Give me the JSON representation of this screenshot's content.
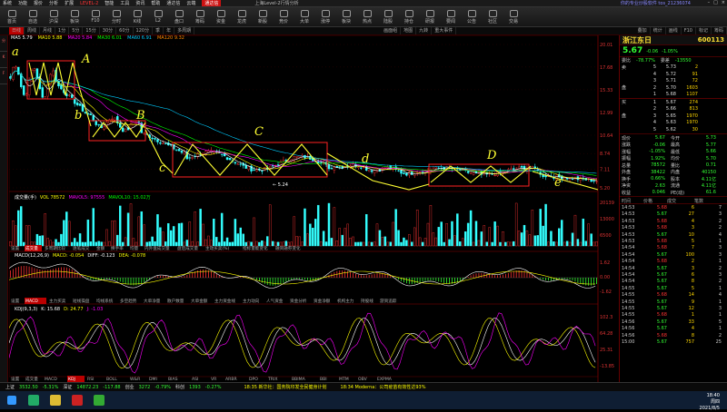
{
  "menubar": {
    "items": [
      "系统",
      "功能",
      "报价",
      "分析",
      "扩展",
      "LEVEL-2",
      "智能",
      "工具",
      "资讯",
      "帮助",
      "通达信",
      "云端"
    ],
    "brand": "通达信",
    "title": "上海Level-2行情分析",
    "user": "你的专业炒股软件 tos_21236074"
  },
  "toolbar": {
    "items": [
      "首页",
      "自选",
      "沪深",
      "板块",
      "F10",
      "分时",
      "K线",
      "L2",
      "盘口",
      "筹码",
      "资金",
      "龙虎",
      "新股",
      "竞价",
      "大单",
      "涨停",
      "板块",
      "热点",
      "陆股",
      "持仓",
      "研报",
      "要闻",
      "公告",
      "社区",
      "交易"
    ]
  },
  "chart_header": {
    "tabs": [
      "日线",
      "周线",
      "月线",
      "1分",
      "5分",
      "15分",
      "30分",
      "60分",
      "120分",
      "季",
      "年",
      "多周期"
    ],
    "ma_labels": [
      "MA5 5.79",
      "MA10 5.88",
      "MA20 5.84",
      "MA30 6.01",
      "MA60 6.91",
      "MA120 9.32"
    ],
    "right_tabs": [
      "叠加",
      "统计",
      "画线",
      "F10",
      "标记",
      "筹码"
    ],
    "event_tabs": [
      "画面组",
      "地图",
      "九转",
      "重大事件"
    ]
  },
  "price_axis": [
    "20.01",
    "17.68",
    "15.33",
    "12.99",
    "10.64",
    "8.74",
    "7.11",
    "5.20"
  ],
  "annotations": [
    "a",
    "A",
    "b",
    "B",
    "c",
    "C",
    "d",
    "D",
    "e"
  ],
  "volume_panel": {
    "title": "成交量(手)",
    "vol": "VOL 78572",
    "mavol5": "MAVOL5: 97555",
    "mavol10": "MAVOL10: 15.02万",
    "axis": [
      "20139",
      "13000",
      "6500"
    ],
    "tabs": [
      "设置",
      "成交量",
      "多周期比较",
      "逐笔成交",
      "金额",
      "换手率",
      "均量",
      "内外盘成交量",
      "盘后成交量",
      "主动买卖(%)",
      "指标量能变化",
      "融资融券变化"
    ]
  },
  "macd_panel": {
    "title": "MACD(12,26,9)",
    "macd": "MACD: -0.054",
    "diff": "DIFF: -0.123",
    "dea": "DEA: -0.078",
    "axis": [
      "1.62",
      "0.00",
      "-1.62"
    ],
    "tabs": [
      "设置",
      "MACD",
      "主力买卖",
      "短线操盘",
      "均线系统",
      "多空趋势",
      "大单净量",
      "散户数量",
      "大单金额",
      "主力资金线",
      "主力动向",
      "人气资金",
      "资金分析",
      "资金净额",
      "机构主力",
      "持股线",
      "游资追踪"
    ]
  },
  "kdj_panel": {
    "title": "KDJ(9,3,3)",
    "k": "K: 15.68",
    "d": "D: 24.77",
    "j": "J: -1.03",
    "axis": [
      "102.3",
      "64.28",
      "25.31",
      "-13.85"
    ],
    "tabs": [
      "设置",
      "成交量",
      "MACD",
      "KDJ",
      "RSI",
      "BOLL",
      "W&R",
      "DMI",
      "BIAS",
      "ASI",
      "VR",
      "ARBR",
      "DPO",
      "TRIX",
      "BBIMA",
      "BBI",
      "MTM",
      "OBV",
      "EXPMA"
    ]
  },
  "stock": {
    "name": "浙江东日",
    "code": "600113",
    "price": "5.67",
    "change": "-0.06",
    "pct": "-1.05%"
  },
  "order_book": {
    "header": [
      "委比",
      "-78.77%",
      "委差",
      "-13550"
    ],
    "asks": [
      {
        "label": "卖",
        "lv": "5",
        "price": "5.73",
        "vol": "2"
      },
      {
        "label": "",
        "lv": "4",
        "price": "5.72",
        "vol": "91"
      },
      {
        "label": "",
        "lv": "3",
        "price": "5.71",
        "vol": "72"
      },
      {
        "label": "盘",
        "lv": "2",
        "price": "5.70",
        "vol": "1603"
      },
      {
        "label": "",
        "lv": "1",
        "price": "5.68",
        "vol": "1107"
      }
    ],
    "bids": [
      {
        "label": "买",
        "lv": "1",
        "price": "5.67",
        "vol": "274"
      },
      {
        "label": "",
        "lv": "2",
        "price": "5.66",
        "vol": "813"
      },
      {
        "label": "盘",
        "lv": "3",
        "price": "5.65",
        "vol": "1970"
      },
      {
        "label": "",
        "lv": "4",
        "price": "5.63",
        "vol": "1970"
      },
      {
        "label": "",
        "lv": "5",
        "price": "5.62",
        "vol": "30"
      }
    ]
  },
  "stats": [
    [
      "现价",
      "5.67",
      "今开",
      "5.73"
    ],
    [
      "涨跌",
      "-0.06",
      "最高",
      "5.77"
    ],
    [
      "涨幅",
      "-1.05%",
      "最低",
      "5.66"
    ],
    [
      "振幅",
      "1.92%",
      "均价",
      "5.70"
    ],
    [
      "总量",
      "78572",
      "量比",
      "0.71"
    ],
    [
      "外盘",
      "38422",
      "内盘",
      "40150"
    ],
    [
      "换手",
      "0.66%",
      "股本",
      "4.11亿"
    ],
    [
      "净资",
      "2.63",
      "流通",
      "4.11亿"
    ],
    [
      "收益",
      "0.046",
      "PE(动)",
      "61.6"
    ]
  ],
  "ticks_header": [
    "时间",
    "价格",
    "成交",
    "笔数"
  ],
  "ticks": [
    [
      "14:53",
      "5.68",
      "6",
      "7"
    ],
    [
      "14:53",
      "5.67",
      "27",
      "3"
    ],
    [
      "14:53",
      "5.68",
      "4",
      "2"
    ],
    [
      "14:53",
      "5.68",
      "3",
      "2"
    ],
    [
      "14:53",
      "5.67",
      "10",
      "4"
    ],
    [
      "14:53",
      "5.68",
      "5",
      "1"
    ],
    [
      "14:54",
      "5.68",
      "7",
      "3"
    ],
    [
      "14:54",
      "5.67",
      "100",
      "3"
    ],
    [
      "14:54",
      "5.68",
      "2",
      "1"
    ],
    [
      "14:54",
      "5.67",
      "3",
      "2"
    ],
    [
      "14:54",
      "5.67",
      "6",
      "3"
    ],
    [
      "14:54",
      "5.67",
      "8",
      "2"
    ],
    [
      "14:55",
      "5.67",
      "5",
      "1"
    ],
    [
      "14:55",
      "5.68",
      "14",
      "4"
    ],
    [
      "14:55",
      "5.67",
      "9",
      "1"
    ],
    [
      "14:55",
      "5.67",
      "12",
      "3"
    ],
    [
      "14:55",
      "5.68",
      "1",
      "1"
    ],
    [
      "14:56",
      "5.67",
      "33",
      "5"
    ],
    [
      "14:56",
      "5.67",
      "4",
      "1"
    ],
    [
      "14:56",
      "5.68",
      "8",
      "2"
    ],
    [
      "15:00",
      "5.67",
      "757",
      "25"
    ]
  ],
  "bottom": {
    "indices": [
      {
        "name": "上证",
        "val": "3532.50",
        "chg": "-5.31%"
      },
      {
        "name": "深证",
        "val": "14872.23",
        "chg": "-117.88"
      },
      {
        "name": "创业",
        "val": "3272",
        "chg": "-0.79%"
      },
      {
        "name": "科创",
        "val": "1393",
        "chg": "-0.27%"
      }
    ],
    "news1": "18:35 新华社：国务院印发全民健身计划",
    "news2": "18:34 Moderna：公司疫苗有效性达93%",
    "clock_time": "18:40",
    "clock_day": "周四",
    "clock_date": "2021/8/5"
  },
  "colors": {
    "up": "#ff3333",
    "down": "#33ff33",
    "annot": "#ffff33",
    "box": "#ff2222"
  }
}
